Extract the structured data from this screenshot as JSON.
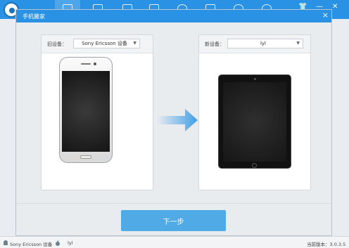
{
  "app": {
    "title": "手机搬家",
    "window_buttons": {
      "shirt": "👕",
      "minimize": "—",
      "close": "✕"
    }
  },
  "dialog": {
    "close_label": "×",
    "old_device": {
      "label": "旧设备：",
      "value": "Sony Ericsson 设备"
    },
    "new_device": {
      "label": "新设备：",
      "value": "lyl"
    },
    "next_label": "下一步"
  },
  "statusbar": {
    "device1": "Sony Ericsson 设备",
    "device2": "lyl",
    "version": "当前版本：3.0.3.5"
  },
  "colors": {
    "accent": "#2a92e4",
    "button": "#4faae6",
    "arrow": "#3f9fe6"
  },
  "icons": [
    "app-logo-icon",
    "phone-tab-icon",
    "apps-tab-icon",
    "music-tab-icon",
    "photos-tab-icon",
    "video-tab-icon",
    "ringtone-tab-icon",
    "search-tab-icon",
    "tools-tab-icon",
    "close-icon",
    "caret-down-icon",
    "transfer-arrow-icon",
    "android-icon",
    "apple-icon"
  ]
}
